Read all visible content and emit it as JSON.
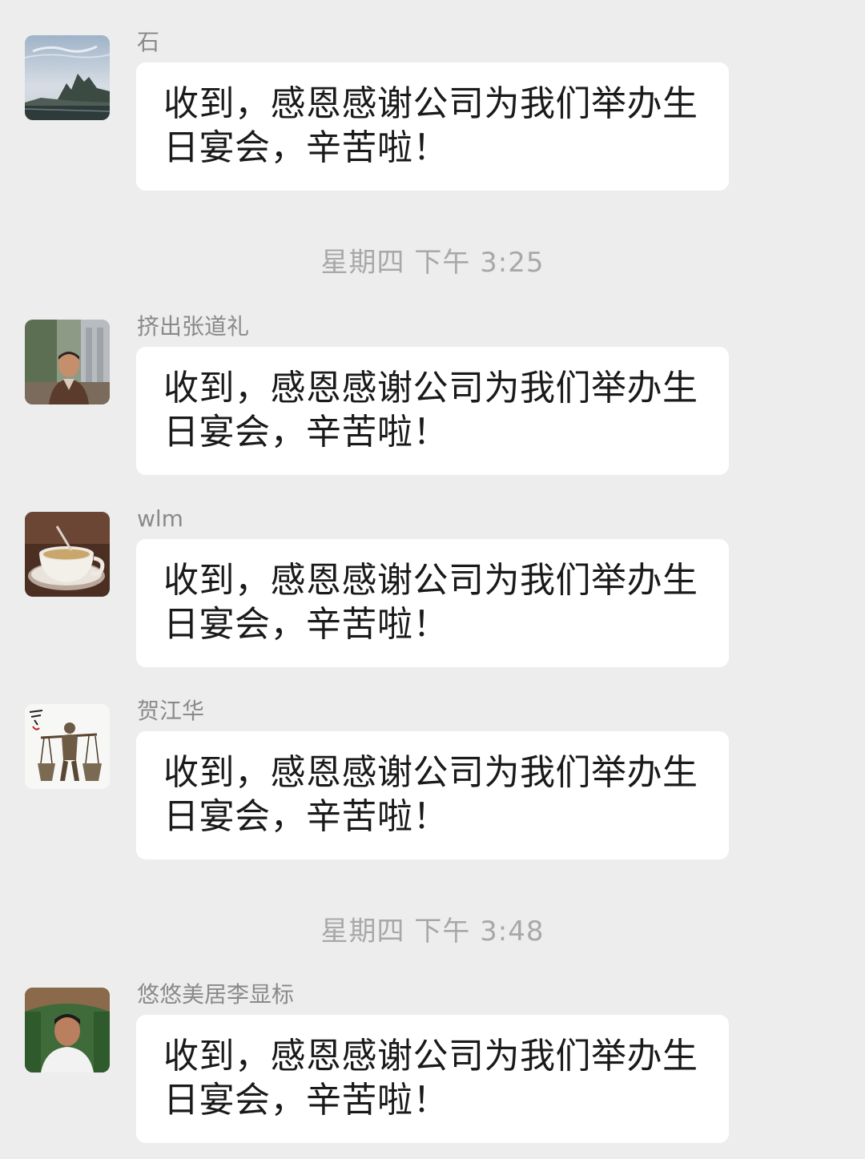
{
  "messages_top": [
    {
      "sender": "石",
      "text": "收到，感恩感谢公司为我们举办生日宴会，辛苦啦！",
      "avatar_icon": "landscape-mountain-river-avatar"
    }
  ],
  "timestamps": [
    "星期四 下午 3:25",
    "星期四 下午 3:48"
  ],
  "messages_mid": [
    {
      "sender": "挤出张道礼",
      "text": "收到，感恩感谢公司为我们举办生日宴会，辛苦啦！",
      "avatar_icon": "man-outdoor-portrait-avatar"
    },
    {
      "sender": "wlm",
      "text": "收到，感恩感谢公司为我们举办生日宴会，辛苦啦！",
      "avatar_icon": "coffee-cup-avatar"
    },
    {
      "sender": "贺江华",
      "text": "收到，感恩感谢公司为我们举办生日宴会，辛苦啦！",
      "avatar_icon": "carrying-pole-statue-avatar"
    }
  ],
  "messages_bottom": [
    {
      "sender": "悠悠美居李显标",
      "text": "收到，感恩感谢公司为我们举办生日宴会，辛苦啦！",
      "avatar_icon": "man-green-background-avatar"
    }
  ],
  "colors": {
    "background": "#ededed",
    "bubble": "#ffffff",
    "sender_name": "#8a8a8a",
    "timestamp": "#a8a8a8",
    "message_text": "#1a1a1a"
  }
}
